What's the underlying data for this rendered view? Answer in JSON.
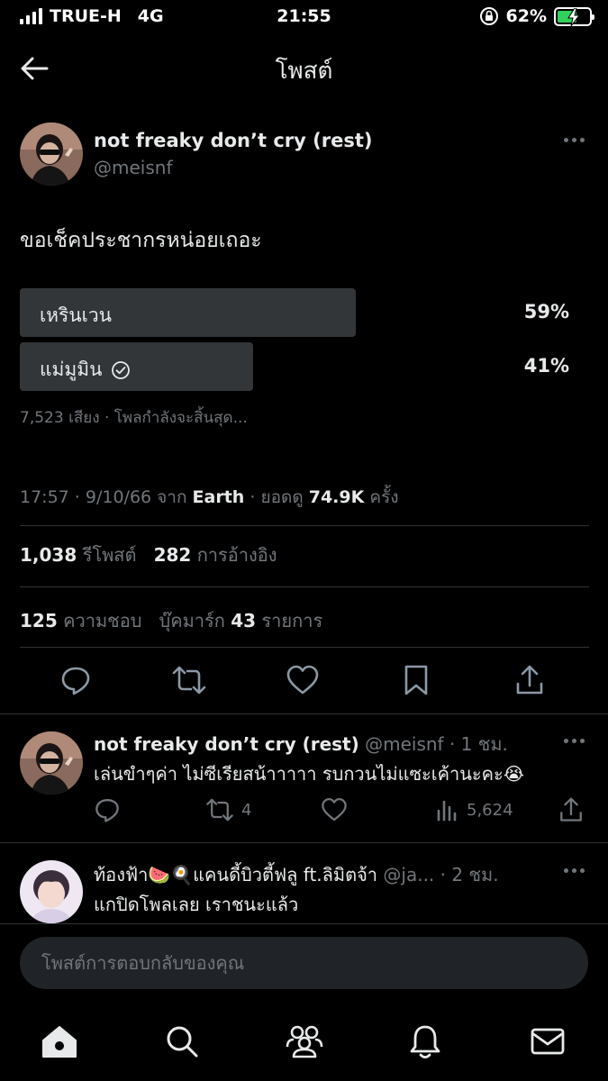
{
  "status_bar": {
    "carrier": "TRUE-H",
    "network": "4G",
    "time": "21:55",
    "battery": "62%",
    "battery_level": 0.62
  },
  "header": {
    "title": "โพสต์"
  },
  "main_tweet": {
    "author_name": "not freaky don’t cry (rest)",
    "author_handle": "@meisnf",
    "text": "ขอเช็คประชากรหน่อยเถอะ",
    "poll": {
      "options": [
        {
          "label": "เหรินเวน",
          "percent": "59%",
          "value": 0.59,
          "selected": false
        },
        {
          "label": "แม่มูมิน",
          "percent": "41%",
          "value": 0.41,
          "selected": true
        }
      ],
      "votes": "7,523",
      "votes_label": "เสียง",
      "status": "โพลกำลังจะสิ้นสุด..."
    },
    "timestamp": "17:57 · 9/10/66",
    "source_prefix": "จาก",
    "source": "Earth",
    "views_prefix": "ยอดดู",
    "views": "74.9K",
    "views_suffix": "ครั้ง",
    "reposts": "1,038",
    "reposts_label": "รีโพสต์",
    "quotes": "282",
    "quotes_label": "การอ้างอิง",
    "likes": "125",
    "likes_label": "ความชอบ",
    "bookmarks_label": "บุ๊คมาร์ก",
    "bookmarks": "43",
    "bookmarks_suffix": "รายการ"
  },
  "replies": [
    {
      "author_name": "not freaky don’t cry (rest)",
      "author_handle": "@meisnf",
      "time": "1 ชม.",
      "text": "เล่นขำๆค่า ไม่ซีเรียสน้าาาาา รบกวนไม่แซะเค้านะคะ😭",
      "reposts": "4",
      "views": "5,624"
    },
    {
      "author_name": "ท้องฟ้า🍉🍳แคนดี้บิวตี้ฟลู ft.ลิมิตจ้า",
      "author_handle": "@ja...",
      "time": "2 ชม.",
      "text": "แกปิดโพลเลย เราชนะแล้ว"
    }
  ],
  "compose": {
    "placeholder": "โพสต์การตอบกลับของคุณ"
  },
  "colors": {
    "background": "#000000",
    "text": "#e7e9ea",
    "secondary": "#71767b",
    "poll_bar": "#333639",
    "divider": "#2f3336",
    "battery": "#30d158"
  }
}
